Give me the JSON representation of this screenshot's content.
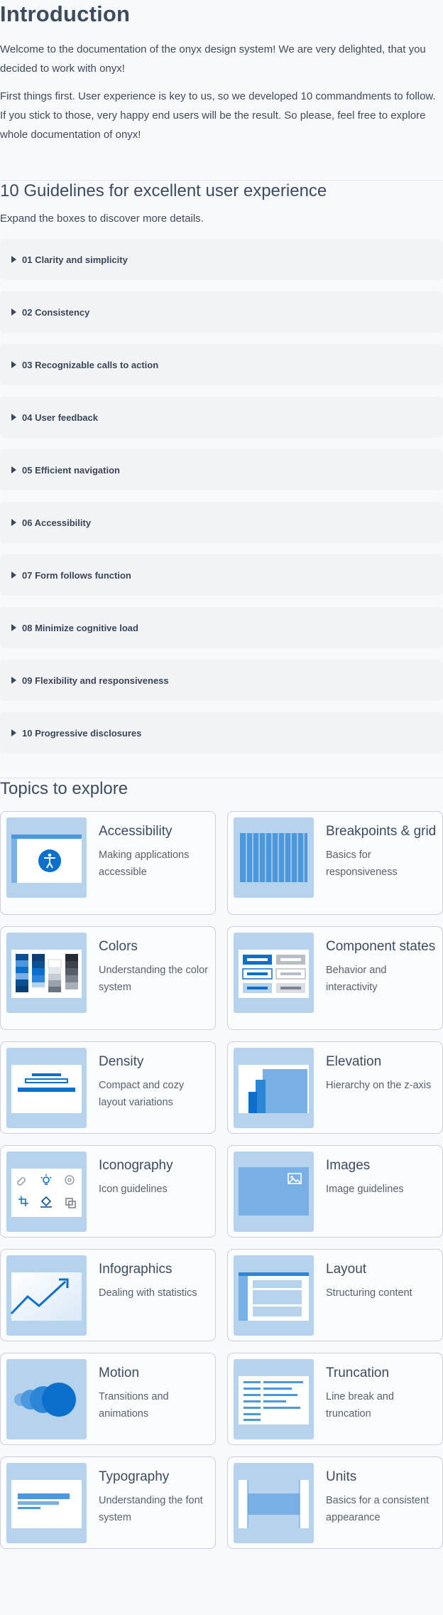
{
  "intro": {
    "title": "Introduction",
    "paragraph1": "Welcome to the documentation of the onyx design system! We are very delighted, that you decided to work with onyx!",
    "paragraph2": "First things first. User experience is key to us, so we developed 10 commandments to follow. If you stick to those, very happy end users will be the result. So please, feel free to explore whole documentation of onyx!"
  },
  "guidelines": {
    "title": "10 Guidelines for excellent user experience",
    "subtitle": "Expand the boxes to discover more details.",
    "items": [
      {
        "label": "01 Clarity and simplicity"
      },
      {
        "label": "02 Consistency"
      },
      {
        "label": "03 Recognizable calls to action"
      },
      {
        "label": "04 User feedback"
      },
      {
        "label": "05 Efficient navigation"
      },
      {
        "label": "06 Accessibility"
      },
      {
        "label": "07 Form follows function"
      },
      {
        "label": "08 Minimize cognitive load"
      },
      {
        "label": "09 Flexibility and responsiveness"
      },
      {
        "label": "10 Progressive disclosures"
      }
    ]
  },
  "topics": {
    "title": "Topics to explore",
    "cards": [
      {
        "title": "Accessibility",
        "description": "Making applications accessible",
        "icon": "accessibility-illustration"
      },
      {
        "title": "Breakpoints & grid",
        "description": "Basics for responsiveness",
        "icon": "grid-illustration"
      },
      {
        "title": "Colors",
        "description": "Understanding the color system",
        "icon": "color-swatches-illustration"
      },
      {
        "title": "Component states",
        "description": "Behavior and interactivity",
        "icon": "component-states-illustration"
      },
      {
        "title": "Density",
        "description": "Compact and cozy layout variations",
        "icon": "density-illustration"
      },
      {
        "title": "Elevation",
        "description": "Hierarchy on the z-axis",
        "icon": "elevation-illustration"
      },
      {
        "title": "Iconography",
        "description": "Icon guidelines",
        "icon": "icon-set-illustration"
      },
      {
        "title": "Images",
        "description": "Image guidelines",
        "icon": "image-illustration"
      },
      {
        "title": "Infographics",
        "description": "Dealing with statistics",
        "icon": "trend-chart-illustration"
      },
      {
        "title": "Layout",
        "description": "Structuring content",
        "icon": "layout-illustration"
      },
      {
        "title": "Motion",
        "description": "Transitions and animations",
        "icon": "motion-circles-illustration"
      },
      {
        "title": "Truncation",
        "description": "Line break and truncation",
        "icon": "text-lines-illustration"
      },
      {
        "title": "Typography",
        "description": "Understanding the font system",
        "icon": "typography-illustration"
      },
      {
        "title": "Units",
        "description": "Basics for a consistent appearance",
        "icon": "units-illustration"
      }
    ]
  },
  "colors": {
    "background": "#f8f9fc",
    "accordion_bg": "#f1f3f7",
    "thumb_bg": "#b6d3ee",
    "primary": "#0b6fcc",
    "text": "#3d4b5f"
  }
}
